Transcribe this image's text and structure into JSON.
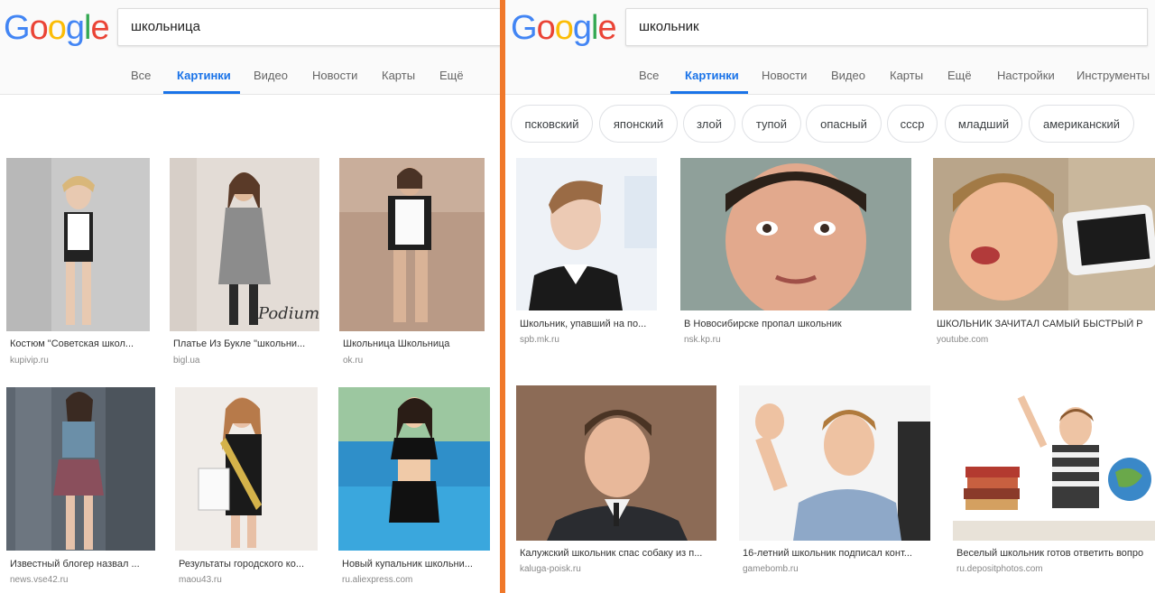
{
  "left": {
    "logo_text": "Google",
    "search_query": "школьница",
    "tabs": [
      "Все",
      "Картинки",
      "Видео",
      "Новости",
      "Карты",
      "Ещё"
    ],
    "results": [
      {
        "caption": "Костюм \"Советская школ...",
        "source": "kupivip.ru"
      },
      {
        "caption": "Платье Из Букле \"школьни...",
        "source": "bigl.ua"
      },
      {
        "caption": "Школьница Школьница",
        "source": "ok.ru"
      },
      {
        "caption": "Известный блогер назвал ...",
        "source": "news.vse42.ru"
      },
      {
        "caption": "Результаты городского ко...",
        "source": "maou43.ru"
      },
      {
        "caption": "Новый купальник школьни...",
        "source": "ru.aliexpress.com"
      }
    ],
    "watermark": "Podium"
  },
  "right": {
    "logo_text": "Google",
    "search_query": "школьник",
    "tabs": [
      "Все",
      "Картинки",
      "Новости",
      "Видео",
      "Карты",
      "Ещё",
      "Настройки",
      "Инструменты"
    ],
    "chips": [
      "псковский",
      "японский",
      "злой",
      "тупой",
      "опасный",
      "ссср",
      "младший",
      "американский"
    ],
    "results": [
      {
        "caption": "Школьник, упавший на по...",
        "source": "spb.mk.ru"
      },
      {
        "caption": "В Новосибирске пропал школьник",
        "source": "nsk.kp.ru"
      },
      {
        "caption": "ШКОЛЬНИК ЗАЧИТАЛ САМЫЙ БЫСТРЫЙ Р",
        "source": "youtube.com"
      },
      {
        "caption": "Калужский школьник спас собаку из п...",
        "source": "kaluga-poisk.ru"
      },
      {
        "caption": "16-летний школьник подписал конт...",
        "source": "gamebomb.ru"
      },
      {
        "caption": "Веселый школьник готов ответить вопро",
        "source": "ru.depositphotos.com"
      }
    ]
  },
  "colors": {
    "google_blue": "#4285F4",
    "google_red": "#EA4335",
    "google_yellow": "#FBBC05",
    "google_green": "#34A853",
    "active_tab": "#1a73e8",
    "divider": "#f0782a"
  }
}
